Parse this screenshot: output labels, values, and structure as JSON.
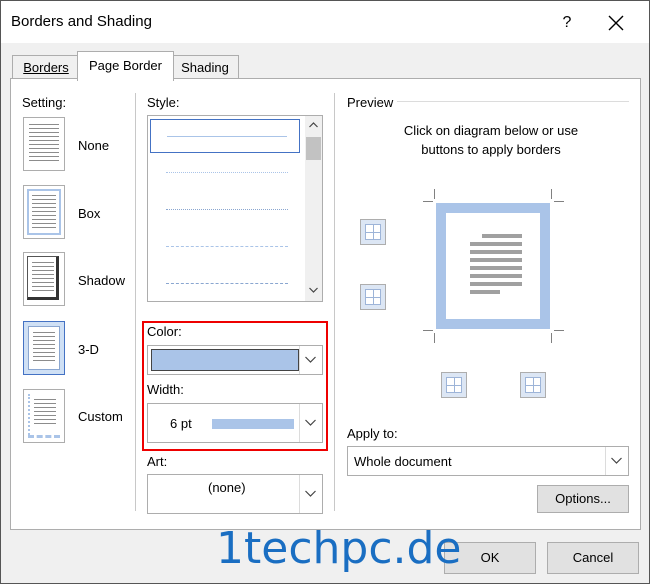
{
  "window": {
    "title": "Borders and Shading",
    "help": "?"
  },
  "tabs": [
    {
      "label": "Borders"
    },
    {
      "label": "Page Border"
    },
    {
      "label": "Shading"
    }
  ],
  "setting": {
    "heading": "Setting:",
    "options": [
      {
        "label": "None"
      },
      {
        "label": "Box"
      },
      {
        "label": "Shadow"
      },
      {
        "label": "3-D"
      },
      {
        "label": "Custom"
      }
    ],
    "selected": "3-D"
  },
  "style": {
    "heading": "Style:"
  },
  "color": {
    "label": "Color:",
    "value_color": "#aac4e8"
  },
  "width": {
    "label": "Width:",
    "value": "6 pt",
    "swatch_color": "#aac4e8"
  },
  "art": {
    "label": "Art:",
    "value": "(none)"
  },
  "preview": {
    "heading": "Preview",
    "instructions_line1": "Click on diagram below or use",
    "instructions_line2": "buttons to apply borders"
  },
  "apply_to": {
    "label": "Apply to:",
    "value": "Whole document"
  },
  "buttons": {
    "options": "Options...",
    "ok": "OK",
    "cancel": "Cancel"
  },
  "watermark": "1techpc.de",
  "colors": {
    "highlight": "#ee0000",
    "border_accent": "#aac4e8",
    "selection": "#4472c4"
  }
}
